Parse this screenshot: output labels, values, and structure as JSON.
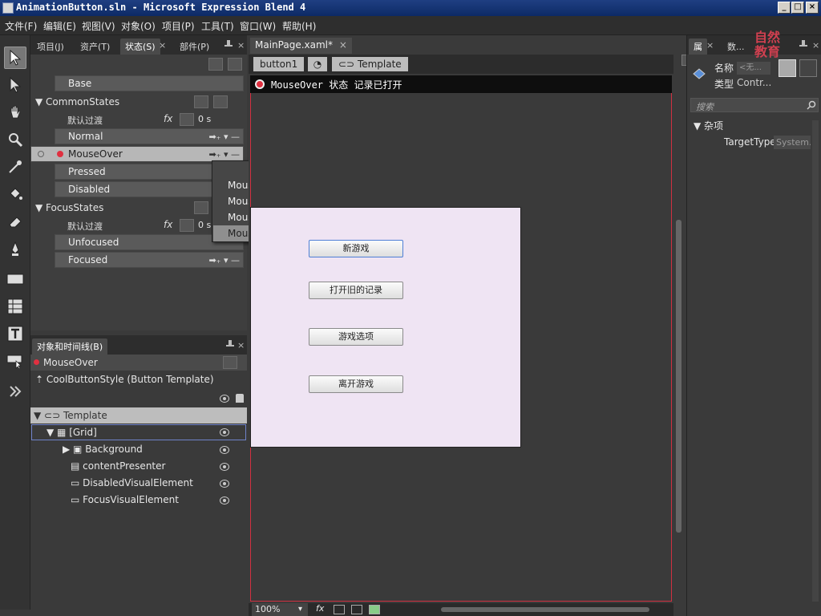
{
  "window": {
    "title": "AnimationButton.sln - Microsoft Expression Blend 4",
    "controls": [
      "_",
      "□",
      "×"
    ]
  },
  "menu": [
    "文件(F)",
    "编辑(E)",
    "视图(V)",
    "对象(O)",
    "项目(P)",
    "工具(T)",
    "窗口(W)",
    "帮助(H)"
  ],
  "states_panel": {
    "tabs": [
      "项目(J)",
      "资产(T)",
      "状态(S)",
      "部件(P)"
    ],
    "active_tab": "状态(S)",
    "base": "Base",
    "groups": [
      {
        "name": "CommonStates",
        "default_transition": "默认过渡",
        "duration": "0 s",
        "states": [
          "Normal",
          "MouseOver",
          "Pressed",
          "Disabled"
        ]
      },
      {
        "name": "FocusStates",
        "default_transition": "默认过渡",
        "duration": "0 s",
        "states": [
          "Unfocused",
          "Focused"
        ]
      }
    ]
  },
  "transition_menu": [
    "★ ➡ MouseOver",
    "MouseOver ➡ Normal",
    "MouseOver ➡ Pressed",
    "MouseOver ➡ Disabled",
    "MouseOver ➡ ★"
  ],
  "objects_panel": {
    "title": "对象和时间线(B)",
    "current_state": "MouseOver",
    "scope": "CoolButtonStyle (Button Template)",
    "tree": {
      "root": "Template",
      "grid": "[Grid]",
      "children": [
        "Background",
        "contentPresenter",
        "DisabledVisualElement",
        "FocusVisualElement"
      ]
    }
  },
  "document": {
    "tab": "MainPage.xaml*",
    "breadcrumb": [
      "button1",
      "Template"
    ],
    "recording": "MouseOver 状态 记录已打开",
    "buttons": [
      "新游戏",
      "打开旧的记录",
      "游戏选项",
      "离开游戏"
    ],
    "zoom": "100%"
  },
  "properties_panel": {
    "tabs": [
      "属",
      "数..."
    ],
    "name_label": "名称",
    "name_value": "<无...",
    "type_label": "类型",
    "type_value": "Contr...",
    "search_placeholder": "搜索",
    "category": "杂项",
    "prop_name": "TargetType",
    "prop_value": "System..."
  },
  "watermark": "自然教育",
  "colors": {
    "record_red": "#e03040",
    "artboard": "#efe4f3",
    "selection_blue": "#4f7fd6"
  }
}
